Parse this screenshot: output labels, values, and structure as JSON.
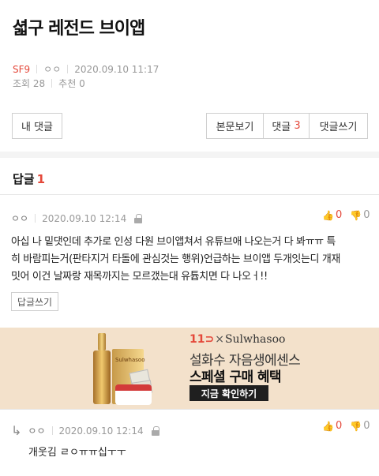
{
  "post": {
    "title": "셟구 레전드 브이앱",
    "category": "SF9",
    "author": "ㅇㅇ",
    "datetime": "2020.09.10 11:17",
    "views_label": "조회 28",
    "recommend_label": "추천 0"
  },
  "actions": {
    "my_comments": "내 댓글",
    "view_body": "본문보기",
    "comments_label": "댓글",
    "comments_count": "3",
    "write_comment": "댓글쓰기"
  },
  "replies": {
    "heading": "답글",
    "count": "1"
  },
  "comment1": {
    "author": "ㅇㅇ",
    "datetime": "2020.09.10 12:14",
    "up": "0",
    "down": "0",
    "lines": [
      "아십 나 밑댓인데 추가로 인성 다원 브이앱쳐서 유튜브애 나오는거 다 봐ㅠㅠ 특",
      "히 바람피는거(판타지거 타돌에 관심것는 행위)언급하는 브이앱 두개잇는디 개재",
      "밋어 이건 날짜랑 재목까지는 모르갰는대 유튭치면 다 나오ㅓ!!"
    ],
    "reply_button": "답글쓰기"
  },
  "ad": {
    "brand_11": "11",
    "brand_x": "×",
    "brand_partner": "Sulwhasoo",
    "line1": "설화수 자음생에센스",
    "line2": "스페셜 구매 혜택",
    "cta": "지금 확인하기",
    "box_label": "Sulwhasoo"
  },
  "comment2": {
    "author": "ㅇㅇ",
    "datetime": "2020.09.10 12:14",
    "up": "0",
    "down": "0",
    "text": "개웃김 ㄹㅇㅠㅠ십ㅜㅜ"
  }
}
